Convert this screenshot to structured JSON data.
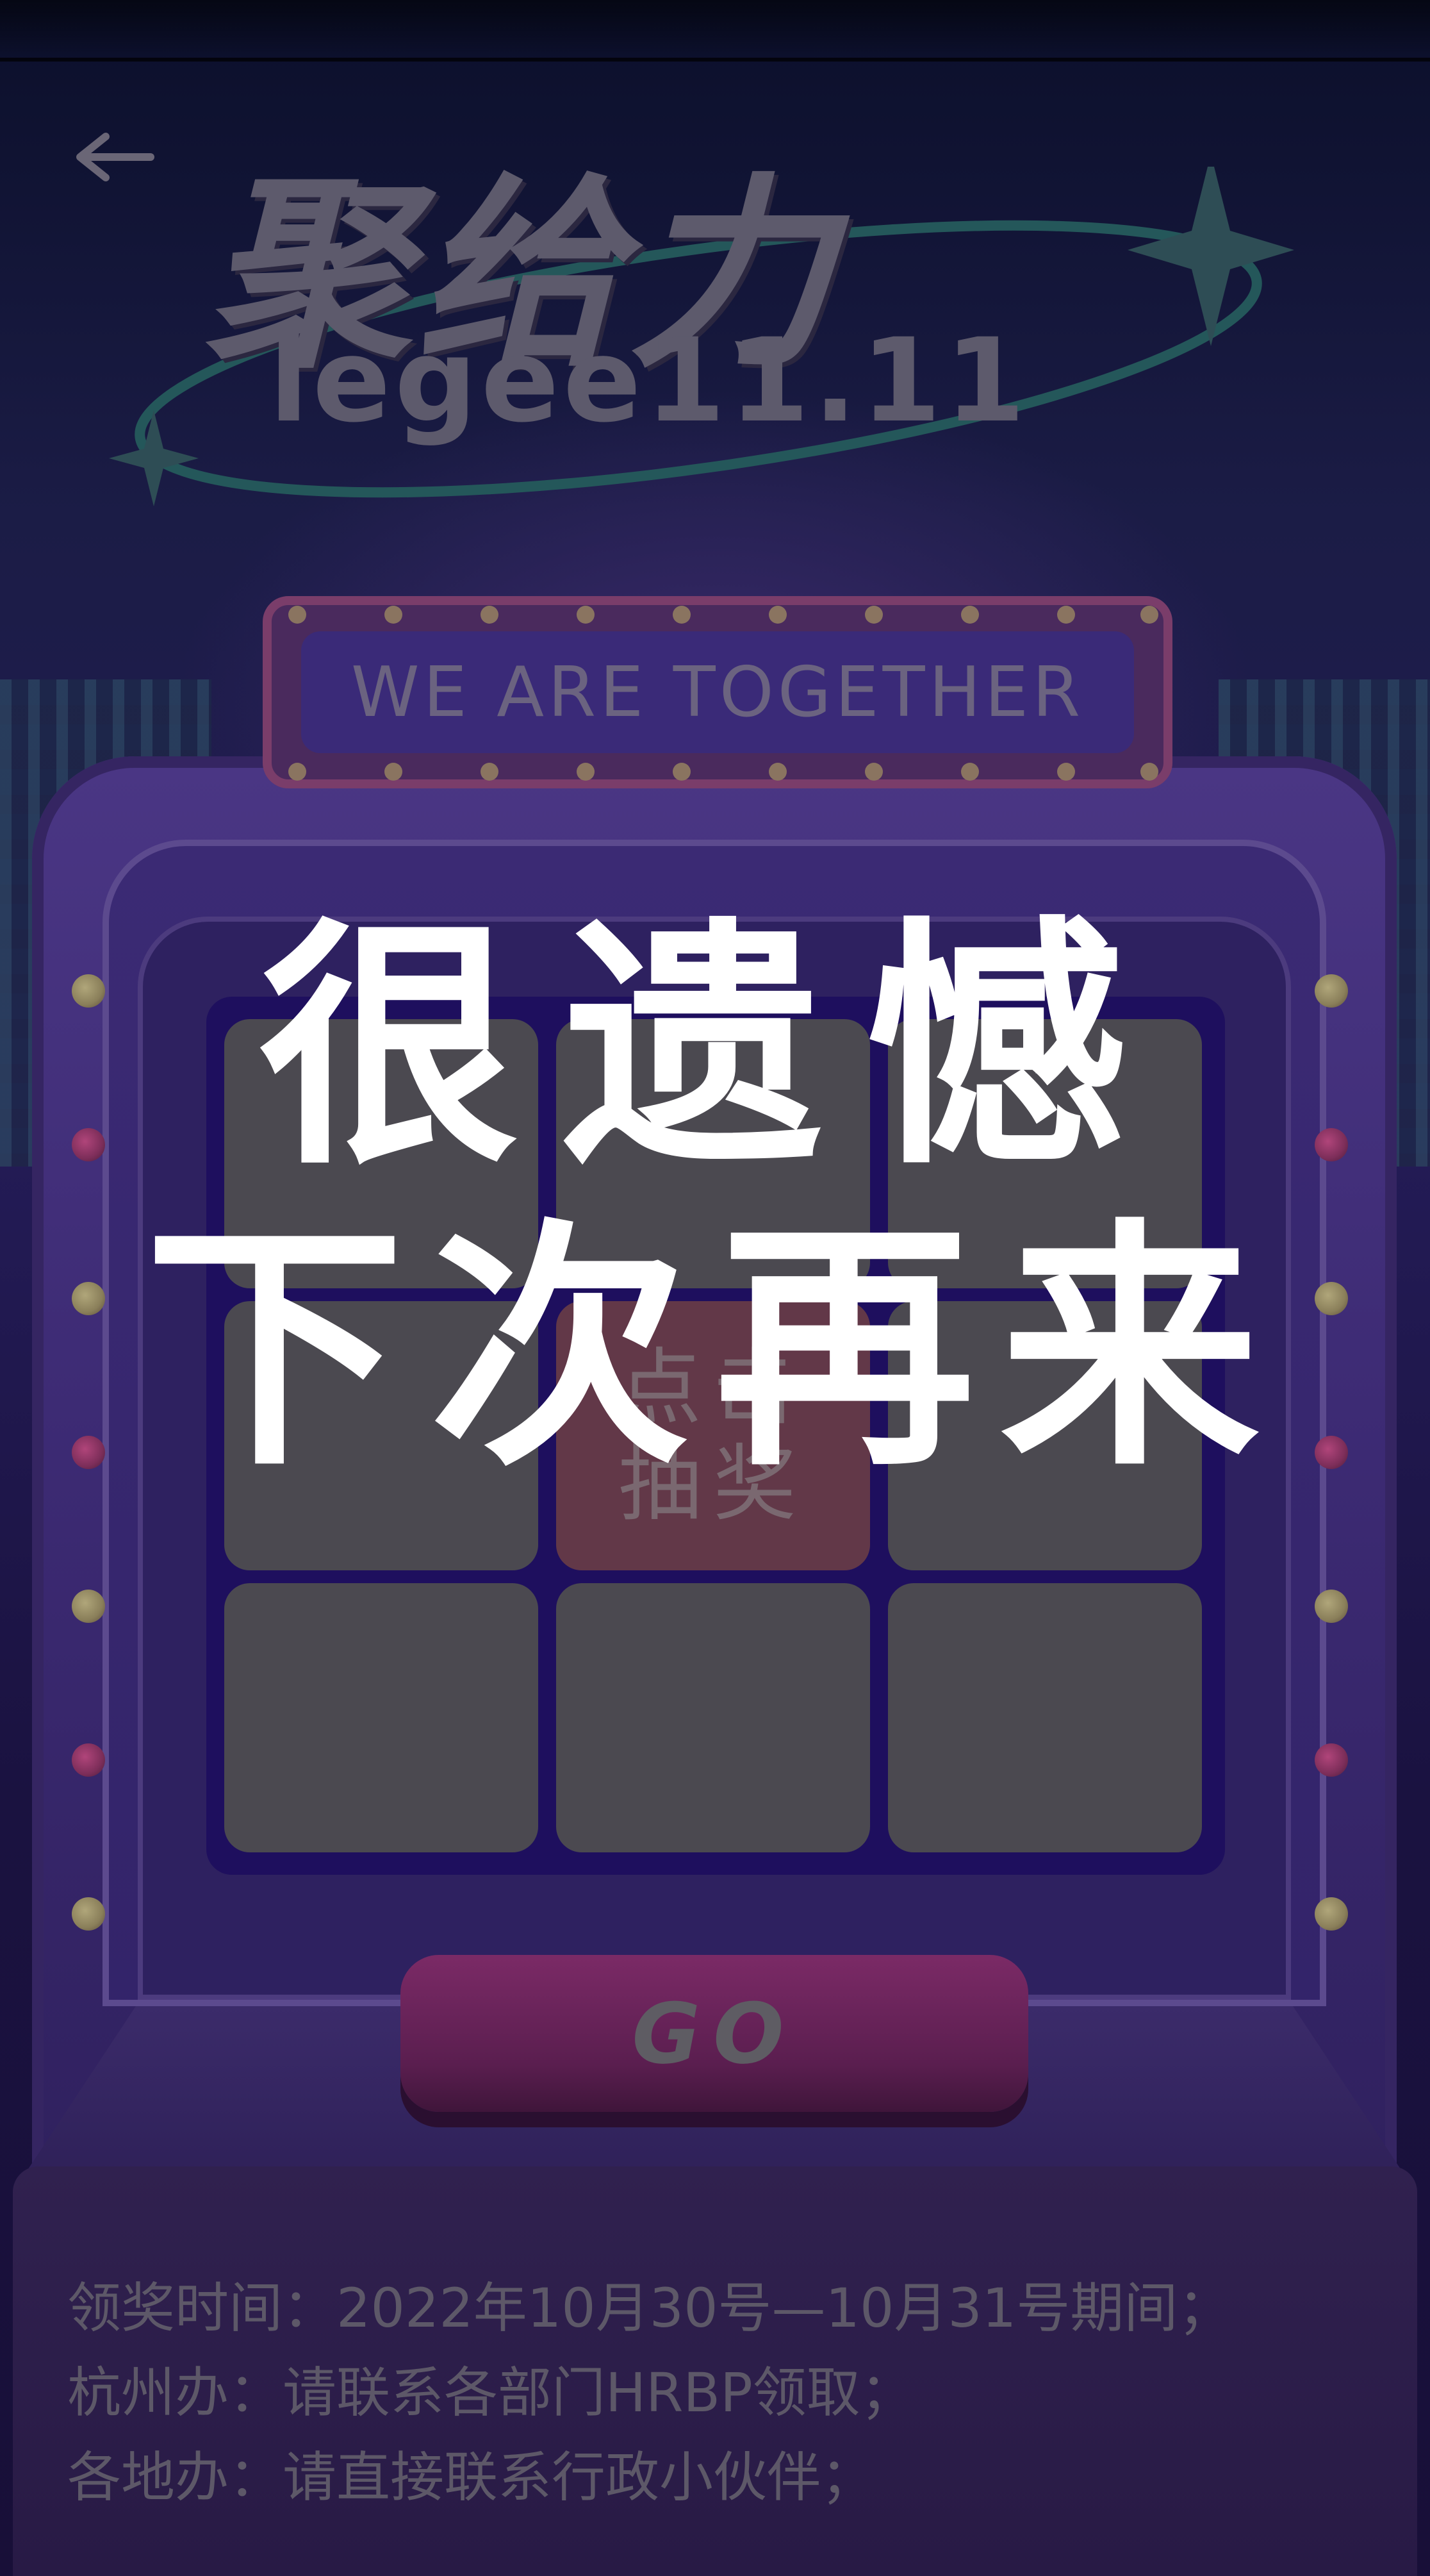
{
  "header": {
    "back_icon": "arrow-left-icon"
  },
  "logo": {
    "title": "聚给力",
    "subtitle": "legee11.11"
  },
  "sign": {
    "text": "WE ARE TOGETHER"
  },
  "grid": {
    "center_line1": "点击",
    "center_line2": "抽奖"
  },
  "go_button": {
    "label": "GO"
  },
  "result": {
    "line1": "很遗憾",
    "line2": "下次再来"
  },
  "info": {
    "line1": "领奖时间：2022年10月30号—10月31号期间；",
    "line2": "杭州办：请联系各部门HRBP领取；",
    "line3": "各地办：请直接联系行政小伙伴；"
  },
  "colors": {
    "background": "#1b1c46",
    "machine": "#3c2a73",
    "cell": "#4b4950",
    "center_cell": "#623848",
    "overlay_text": "#ffffff"
  }
}
